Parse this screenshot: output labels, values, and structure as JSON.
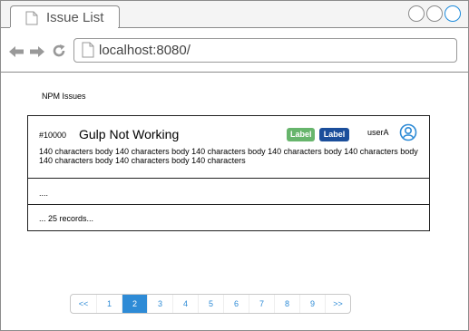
{
  "browser": {
    "tab_title": "Issue List",
    "url": "localhost:8080/"
  },
  "page": {
    "heading": "NPM Issues"
  },
  "issue": {
    "number": "#10000",
    "title": "Gulp Not Working",
    "labels": [
      "Label",
      "Label"
    ],
    "label_colors": [
      "#67b56c",
      "#1b4e9b"
    ],
    "user": "userA",
    "body": "140 characters body 140 characters body 140 characters body 140 characters body 140 characters body 140 characters body 140 characters body 140 characters"
  },
  "more_rows": "....",
  "records": "... 25 records...",
  "pagination": {
    "items": [
      "<<",
      "1",
      "2",
      "3",
      "4",
      "5",
      "6",
      "7",
      "8",
      "9",
      ">>"
    ],
    "active": "2"
  },
  "icons": {
    "back": "back-arrow-icon",
    "forward": "forward-arrow-icon",
    "reload": "reload-icon",
    "page": "page-icon",
    "avatar": "user-icon"
  }
}
